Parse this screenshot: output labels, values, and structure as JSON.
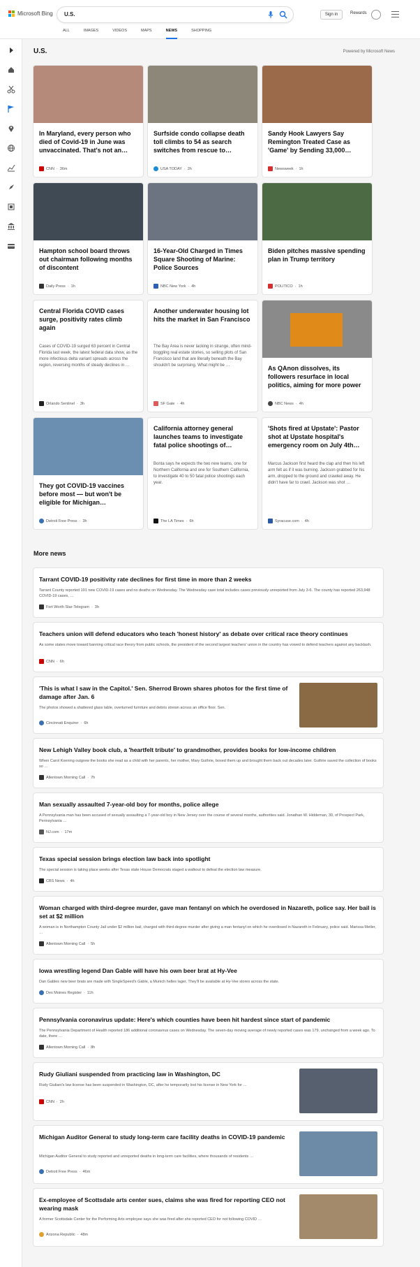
{
  "header": {
    "brand": "Microsoft Bing",
    "query": "U.S.",
    "signin_label": "Sign in",
    "rewards_label": "Rewards",
    "tabs": [
      "ALL",
      "IMAGES",
      "VIDEOS",
      "MAPS",
      "NEWS",
      "SHOPPING"
    ],
    "active_tab": "NEWS"
  },
  "sidebar": {
    "icons": [
      "expand-icon",
      "home-icon",
      "scissors-icon",
      "flag-icon",
      "location-icon",
      "globe-icon",
      "chart-icon",
      "rocket-icon",
      "film-icon",
      "bank-icon",
      "card-icon"
    ]
  },
  "section": {
    "title": "U.S.",
    "powered_by": "Powered by Microsoft News"
  },
  "cards": [
    {
      "title": "In Maryland, every person who died of Covid-19 in June was unvaccinated. That's not an…",
      "snippet": "",
      "source": "CNN",
      "time": "36m",
      "src_color": "#cc0000",
      "img_color": "#b58a7a"
    },
    {
      "title": "Surfside condo collapse death toll climbs to 54 as search switches from rescue to…",
      "snippet": "",
      "source": "USA TODAY",
      "time": "2h",
      "src_color": "#1a8cd8",
      "img_color": "#8d8779"
    },
    {
      "title": "Sandy Hook Lawyers Say Remington Treated Case as 'Game' by Sending 33,000…",
      "snippet": "",
      "source": "Newsweek",
      "time": "1h",
      "src_color": "#d32f2f",
      "img_color": "#9b6a4a"
    },
    {
      "title": "Hampton school board throws out chairman following months of discontent",
      "snippet": "",
      "source": "Daily Press",
      "time": "1h",
      "src_color": "#333333",
      "img_color": "#3f4a55"
    },
    {
      "title": "16-Year-Old Charged in Times Square Shooting of Marine: Police Sources",
      "snippet": "",
      "source": "NBC New York",
      "time": "4h",
      "src_color": "#2c5fb5",
      "img_color": "#6b7480"
    },
    {
      "title": "Biden pitches massive spending plan in Trump territory",
      "snippet": "",
      "source": "POLITICO",
      "time": "1h",
      "src_color": "#d32f2f",
      "img_color": "#4c6b45"
    },
    {
      "title": "Central Florida COVID cases surge, positivity rates climb again",
      "snippet": "Cases of COVID-19 surged 63 percent in Central Florida last week, the latest federal data show, as the more infectious delta variant spreads across the region, reversing months of steady declines in …",
      "source": "Orlando Sentinel",
      "time": "3h",
      "src_color": "#222222",
      "img_color": ""
    },
    {
      "title": "Another underwater housing lot hits the market in San Francisco",
      "snippet": "The Bay Area is never lacking in strange, often mind-boggling real estate stories, so selling plots of San Francisco land that are literally beneath the Bay shouldn't be surprising. What might be …",
      "source": "SF Gate",
      "time": "4h",
      "src_color": "#e05a5a",
      "img_color": ""
    },
    {
      "title": "As QAnon dissolves, its followers resurface in local politics, aiming for more power",
      "snippet": "",
      "source": "NBC News",
      "time": "4h",
      "src_color": "#444444",
      "img_color": "#8a8a8a"
    },
    {
      "title": "They got COVID-19 vaccines before most — but won't be eligible for Michigan…",
      "snippet": "",
      "source": "Detroit Free Press",
      "time": "3h",
      "src_color": "#3a6fb0",
      "img_color": "#6a8fb0"
    },
    {
      "title": "California attorney general launches teams to investigate fatal police shootings of…",
      "snippet": "Bonta says he expects the two new teams, one for Northern California and one for Southern California, to investigate 40 to 50 fatal police shootings each year.",
      "source": "The LA Times",
      "time": "6h",
      "src_color": "#111111",
      "img_color": ""
    },
    {
      "title": "'Shots fired at Upstate': Pastor shot at Upstate hospital's emergency room on July 4th…",
      "snippet": "Marcus Jackson first heard the clap and then his left arm felt as if it was burning. Jackson grabbed for his arm, dropped to the ground and crawled away. He didn't have far to crawl. Jackson was shot …",
      "source": "Syracuse.com",
      "time": "4h",
      "src_color": "#2b5aa5",
      "img_color": ""
    }
  ],
  "more_news": {
    "title": "More news",
    "items": [
      {
        "title": "Tarrant COVID-19 positivity rate declines for first time in more than 2 weeks",
        "snippet": "Tarrant County reported 191 new COVID-19 cases and no deaths on Wednesday. The Wednesday case total includes cases previously unreported from July 3-6. The county has reported 263,948 COVID-19 cases, …",
        "source": "Fort Worth Star-Telegram",
        "time": "3h",
        "src_color": "#333333",
        "has_thumb": false,
        "thumb_color": ""
      },
      {
        "title": "Teachers union will defend educators who teach 'honest history' as debate over critical race theory continues",
        "snippet": "As some states move toward banning critical race theory from public schools, the president of the second largest teachers' union in the country has vowed to defend teachers against any backlash.",
        "source": "CNN",
        "time": "6h",
        "src_color": "#cc0000",
        "has_thumb": false,
        "thumb_color": ""
      },
      {
        "title": "'This is what I saw in the Capitol.' Sen. Sherrod Brown shares photos for the first time of damage after Jan. 6",
        "snippet": "The photos showed a shattered glass table, overturned furniture and debris strewn across an office floor. Sen.",
        "source": "Cincinnati Enquirer",
        "time": "6h",
        "src_color": "#3a6fb0",
        "has_thumb": true,
        "thumb_color": "#8a6a45"
      },
      {
        "title": "New Lehigh Valley book club, a 'heartfelt tribute' to grandmother, provides books for low-income children",
        "snippet": "When Carol Koening outgrew the books she read as a child with her parents, her mother, Mary Guthrie, boxed them up and brought them back out decades later. Guthrie saved the collection of books so …",
        "source": "Allentown Morning Call",
        "time": "7h",
        "src_color": "#333333",
        "has_thumb": false,
        "thumb_color": ""
      },
      {
        "title": "Man sexually assaulted 7-year-old boy for months, police allege",
        "snippet": "A Pennsylvania man has been accused of sexually assaulting a 7-year-old boy in New Jersey over the course of several months, authorities said. Jonathan W. Hiddeman, 30, of Prospect Park, Pennsylvania …",
        "source": "NJ.com",
        "time": "17m",
        "src_color": "#555555",
        "has_thumb": false,
        "thumb_color": ""
      },
      {
        "title": "Texas special session brings election law back into spotlight",
        "snippet": "The special session is taking place weeks after Texas state House Democrats staged a walkout to defeat the election law measure.",
        "source": "CBS News",
        "time": "4h",
        "src_color": "#222222",
        "has_thumb": false,
        "thumb_color": ""
      },
      {
        "title": "Woman charged with third-degree murder, gave man fentanyl on which he overdosed in Nazareth, police say. Her bail is set at $2 million",
        "snippet": "A woman is in Northampton County Jail under $2 million bail, charged with third-degree murder after giving a man fentanyl on which he overdosed in Nazareth in February, police said. Marissa Metler, …",
        "source": "Allentown Morning Call",
        "time": "5h",
        "src_color": "#333333",
        "has_thumb": false,
        "thumb_color": ""
      },
      {
        "title": "Iowa wrestling legend Dan Gable will have his own beer brat at Hy-Vee",
        "snippet": "Dan Gables new beer brats are made with SingleSpeed's Gable, a Munich helles lager. They'll be available at Hy-Vee stores across the state.",
        "source": "Des Moines Register",
        "time": "11h",
        "src_color": "#3a6fb0",
        "has_thumb": false,
        "thumb_color": ""
      },
      {
        "title": "Pennsylvania coronavirus update: Here's which counties have been hit hardest since start of pandemic",
        "snippet": "The Pennsylvania Department of Health reported 186 additional coronavirus cases on Wednesday. The seven-day moving average of newly reported cases was 179, unchanged from a week ago. To date, there …",
        "source": "Allentown Morning Call",
        "time": "8h",
        "src_color": "#333333",
        "has_thumb": false,
        "thumb_color": ""
      },
      {
        "title": "Rudy Giuliani suspended from practicing law in Washington, DC",
        "snippet": "Rudy Giuliani's law license has been suspended in Washington, DC, after he temporarily lost his license in New York for …",
        "source": "CNN",
        "time": "2h",
        "src_color": "#cc0000",
        "has_thumb": true,
        "thumb_color": "#56606e"
      },
      {
        "title": "Michigan Auditor General to study long-term care facility deaths in COVID-19 pandemic",
        "snippet": "Michigan Auditor General to study reported and unreported deaths in long-term care facilities, where thousands of residents …",
        "source": "Detroit Free Press",
        "time": "46m",
        "src_color": "#3a6fb0",
        "has_thumb": true,
        "thumb_color": "#6d8aa6"
      },
      {
        "title": "Ex-employee of Scottsdale arts center sues, claims she was fired for reporting CEO not wearing mask",
        "snippet": "A former Scottsdale Center for the Performing Arts employee says she was fired after she reported CEO for not following COVID …",
        "source": "Arizona Republic",
        "time": "48m",
        "src_color": "#e0a030",
        "has_thumb": true,
        "thumb_color": "#a38a6a"
      }
    ]
  }
}
